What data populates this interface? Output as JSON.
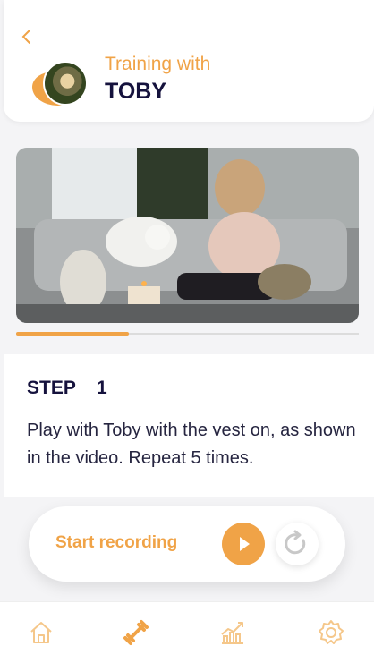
{
  "header": {
    "subtitle": "Training with",
    "title": "TOBY"
  },
  "video": {
    "progress": 0.33
  },
  "step": {
    "label": "STEP",
    "number": "1",
    "instruction": "Play with Toby with the vest on, as shown in the video. Repeat 5 times."
  },
  "recording": {
    "label": "Start recording"
  },
  "nav": {
    "items": [
      {
        "icon": "home-icon",
        "active": false
      },
      {
        "icon": "training-icon",
        "active": true
      },
      {
        "icon": "progress-chart-icon",
        "active": false
      },
      {
        "icon": "settings-icon",
        "active": false
      }
    ]
  },
  "colors": {
    "accent": "#f0a347",
    "dark": "#15123d",
    "inactive_icon": "#f5c78a"
  }
}
